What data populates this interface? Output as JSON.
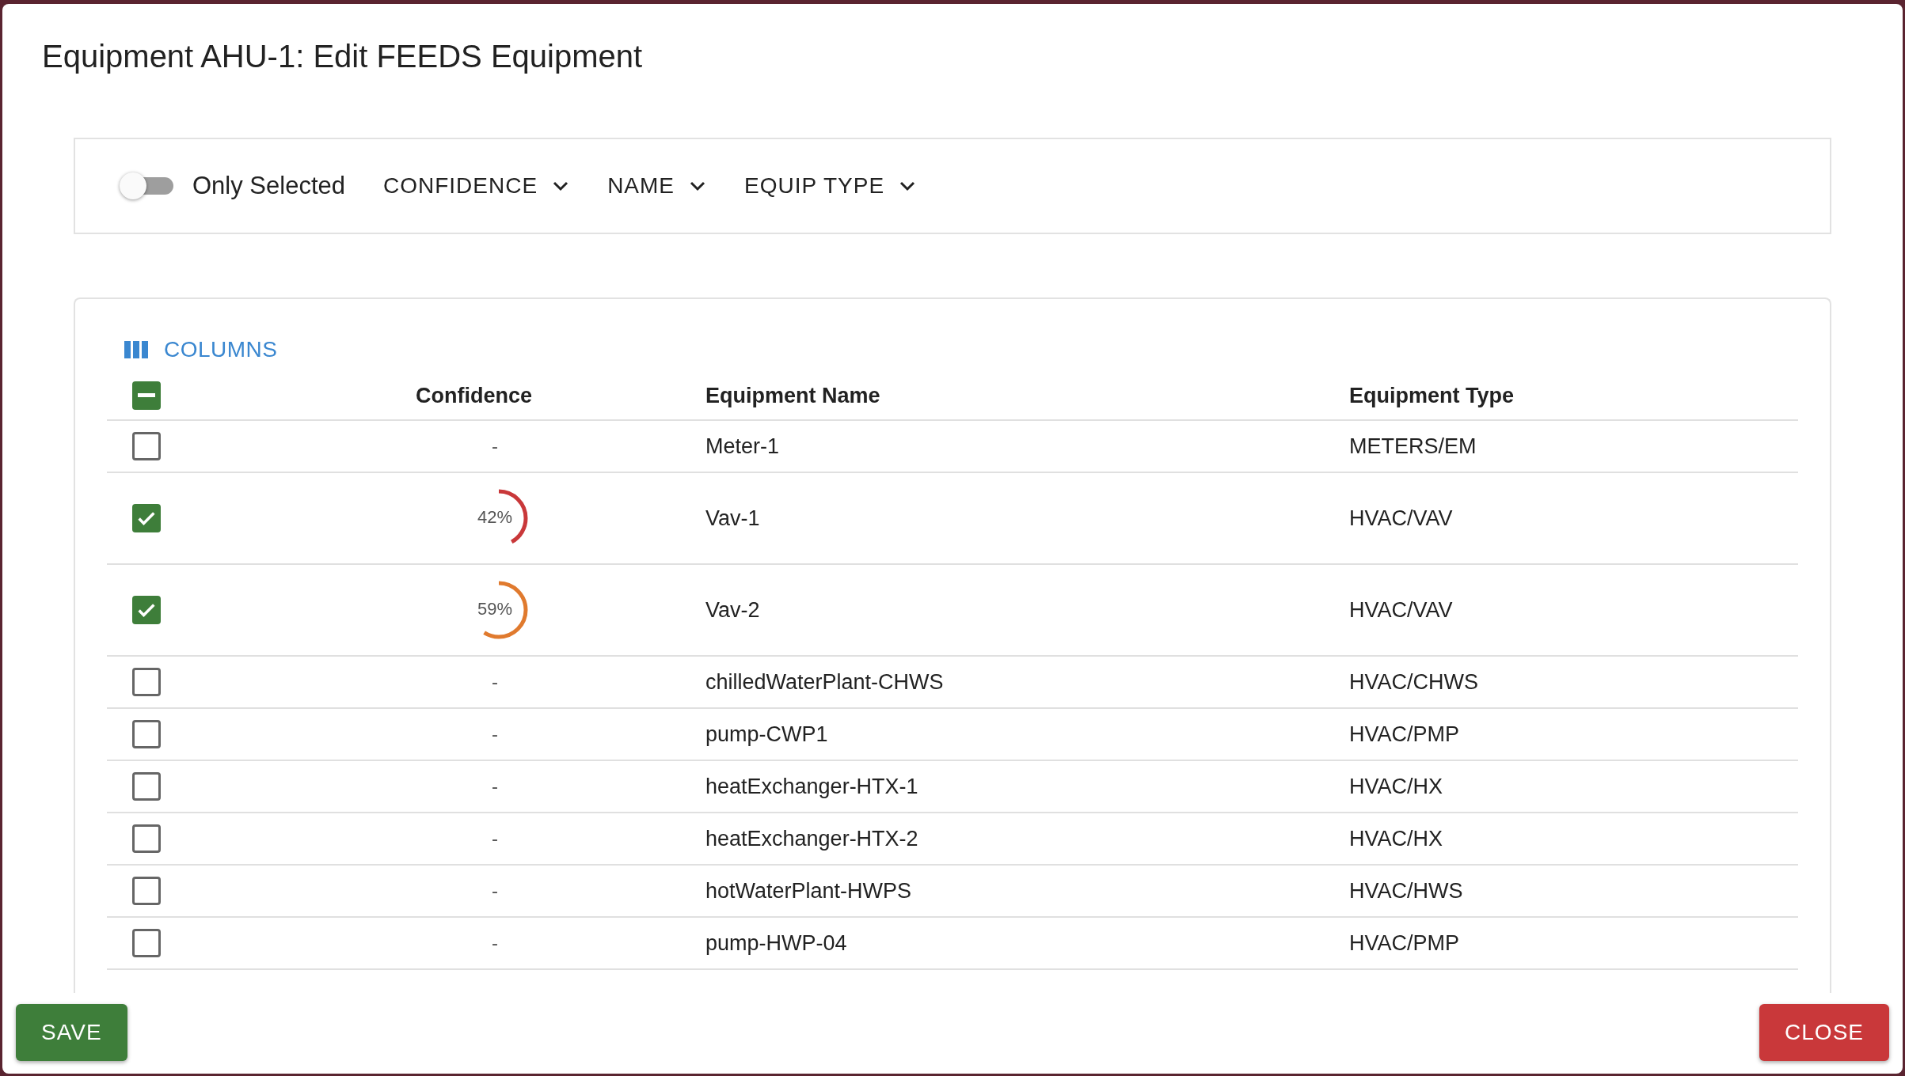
{
  "dialog": {
    "title": "Equipment AHU-1: Edit FEEDS Equipment"
  },
  "filters": {
    "only_selected": {
      "label": "Only Selected",
      "on": false
    },
    "dropdowns": [
      {
        "label": "CONFIDENCE"
      },
      {
        "label": "NAME"
      },
      {
        "label": "EQUIP TYPE"
      }
    ]
  },
  "table": {
    "columns_button": "COLUMNS",
    "select_all": {
      "indeterminate": true
    },
    "columns": [
      "Confidence",
      "Equipment Name",
      "Equipment Type"
    ],
    "rows": [
      {
        "checked": false,
        "confidence": {
          "kind": "dash",
          "text": "-"
        },
        "name": "Meter-1",
        "type": "METERS/EM"
      },
      {
        "checked": true,
        "confidence": {
          "kind": "ring",
          "text": "42%",
          "level": 0.42,
          "color": "#c9383a"
        },
        "name": "Vav-1",
        "type": "HVAC/VAV"
      },
      {
        "checked": true,
        "confidence": {
          "kind": "ring",
          "text": "59%",
          "level": 0.59,
          "color": "#e07a2e"
        },
        "name": "Vav-2",
        "type": "HVAC/VAV"
      },
      {
        "checked": false,
        "confidence": {
          "kind": "dash",
          "text": "-"
        },
        "name": "chilledWaterPlant-CHWS",
        "type": "HVAC/CHWS"
      },
      {
        "checked": false,
        "confidence": {
          "kind": "dash",
          "text": "-"
        },
        "name": "pump-CWP1",
        "type": "HVAC/PMP"
      },
      {
        "checked": false,
        "confidence": {
          "kind": "dash",
          "text": "-"
        },
        "name": "heatExchanger-HTX-1",
        "type": "HVAC/HX"
      },
      {
        "checked": false,
        "confidence": {
          "kind": "dash",
          "text": "-"
        },
        "name": "heatExchanger-HTX-2",
        "type": "HVAC/HX"
      },
      {
        "checked": false,
        "confidence": {
          "kind": "dash",
          "text": "-"
        },
        "name": "hotWaterPlant-HWPS",
        "type": "HVAC/HWS"
      },
      {
        "checked": false,
        "confidence": {
          "kind": "dash",
          "text": "-"
        },
        "name": "pump-HWP-04",
        "type": "HVAC/PMP"
      }
    ]
  },
  "actions": {
    "save": "SAVE",
    "close": "CLOSE"
  }
}
